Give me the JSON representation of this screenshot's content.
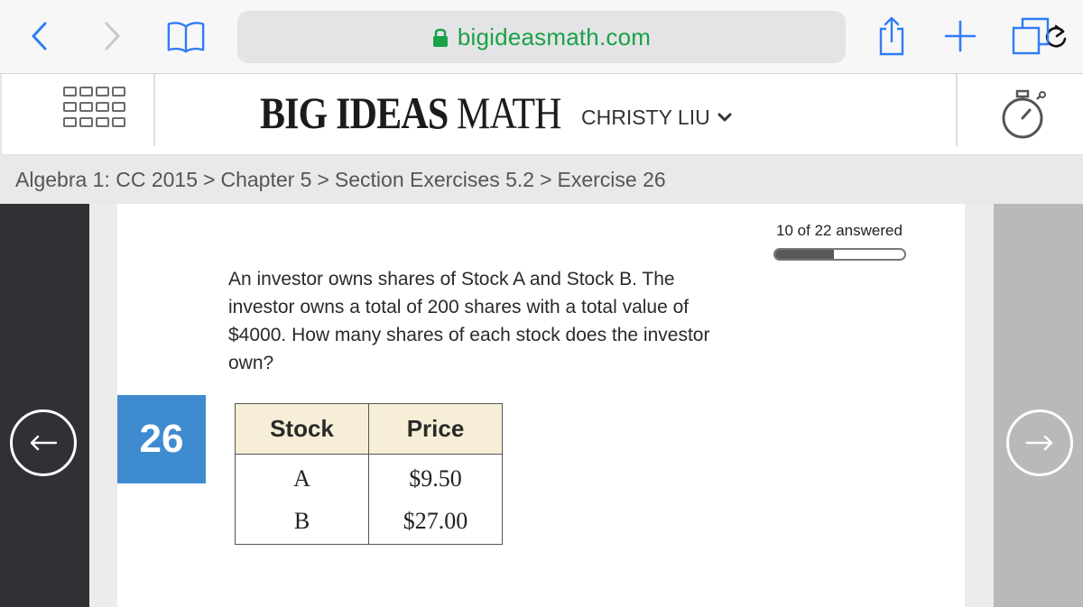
{
  "browser": {
    "url": "bigideasmath.com",
    "icons": [
      "back-icon",
      "forward-icon",
      "bookmarks-icon",
      "lock-icon",
      "reload-icon",
      "share-icon",
      "new-tab-icon",
      "tabs-icon"
    ]
  },
  "header": {
    "brand_main": "BIG IDEAS ",
    "brand_math": "MATH",
    "user_name": "CHRISTY LIU",
    "icons": [
      "grid-menu-icon",
      "chevron-down-icon",
      "stopwatch-icon"
    ]
  },
  "breadcrumb": [
    "Algebra 1: CC 2015",
    "Chapter 5",
    "Section Exercises 5.2",
    "Exercise 26"
  ],
  "progress": {
    "label": "10 of 22 answered",
    "answered": 10,
    "total": 22
  },
  "exercise": {
    "number": "26",
    "question": "An investor owns shares of Stock A and Stock B. The investor owns a total of 200 shares with a total value of $4000. How many shares of each stock does the investor own?",
    "table": {
      "headers": [
        "Stock",
        "Price"
      ],
      "rows": [
        [
          "A",
          "$9.50"
        ],
        [
          "B",
          "$27.00"
        ]
      ]
    }
  },
  "colors": {
    "url_green": "#1aa246",
    "number_badge": "#3f8bd0",
    "table_header": "#f6eed6",
    "left_panel": "#2f3134",
    "right_panel": "#b9b9b9",
    "ios_blue": "#2f7cf6"
  }
}
